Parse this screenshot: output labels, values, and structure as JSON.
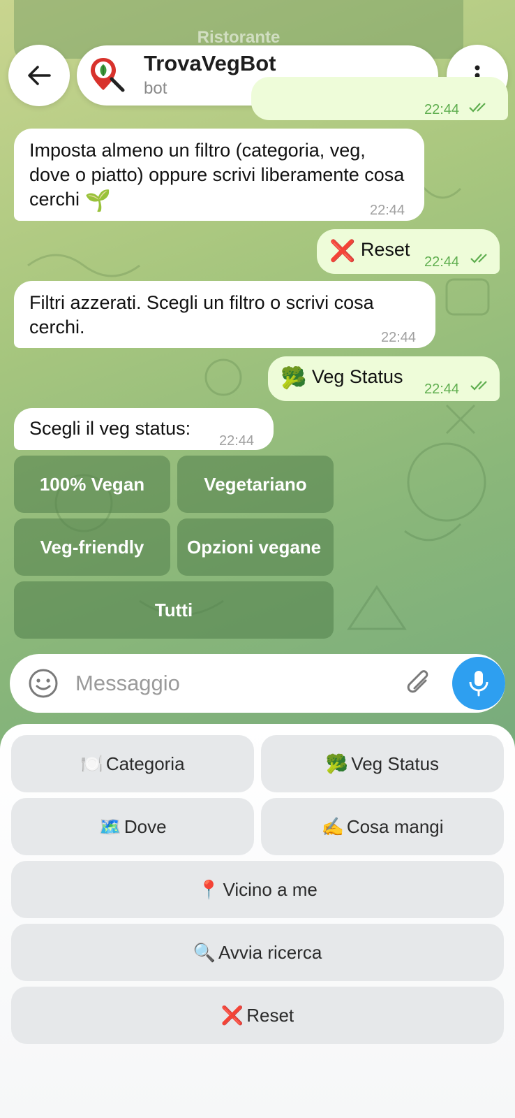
{
  "header": {
    "top_remnant_label": "Ristorante",
    "bot_name": "TrovaVegBot",
    "bot_subtitle": "bot"
  },
  "messages": [
    {
      "kind": "out",
      "time": "22:44"
    },
    {
      "kind": "in",
      "text": "Imposta almeno un filtro (categoria, veg, dove o piatto) oppure scrivi liberamente cosa cerchi",
      "emoji": "🌱",
      "time": "22:44"
    },
    {
      "kind": "out",
      "text": "Reset",
      "emoji": "❌",
      "time": "22:44"
    },
    {
      "kind": "in",
      "text": "Filtri azzerati. Scegli un filtro o scrivi cosa cerchi.",
      "time": "22:44"
    },
    {
      "kind": "out",
      "text": "Veg Status",
      "emoji": "🥦",
      "time": "22:44"
    },
    {
      "kind": "in",
      "text": "Scegli il veg status:",
      "time": "22:44"
    }
  ],
  "inline_keyboard": [
    "100% Vegan",
    "Vegetariano",
    "Veg-friendly",
    "Opzioni vegane",
    "Tutti"
  ],
  "input": {
    "placeholder": "Messaggio"
  },
  "reply_keyboard": [
    {
      "icon": "🍽️",
      "label": "Categoria"
    },
    {
      "icon": "🥦",
      "label": "Veg Status"
    },
    {
      "icon": "🗺️",
      "label": "Dove"
    },
    {
      "icon": "✍️",
      "label": "Cosa mangi"
    },
    {
      "icon": "📍",
      "label": "Vicino a me"
    },
    {
      "icon": "🔍",
      "label": "Avvia ricerca"
    },
    {
      "icon": "❌",
      "label": "Reset"
    }
  ],
  "colors": {
    "accent": "#2e9ff0",
    "outgoing_bubble": "#eefcd9",
    "check": "#5fae4f"
  }
}
